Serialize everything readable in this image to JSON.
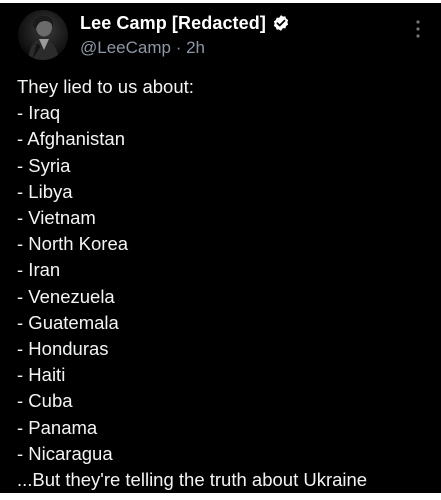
{
  "tweet": {
    "author": {
      "display_name": "Lee Camp [Redacted]",
      "handle": "@LeeCamp",
      "separator": " · ",
      "time": "2h",
      "verified_icon": "verified-badge-icon"
    },
    "more_icon": "more-vertical-icon",
    "lines": [
      "They lied to us about:",
      "- Iraq",
      "- Afghanistan",
      "- Syria",
      "- Libya",
      "- Vietnam",
      "- North Korea",
      "- Iran",
      "- Venezuela",
      "- Guatemala",
      "- Honduras",
      "- Haiti",
      "- Cuba",
      "- Panama",
      "- Nicaragua",
      "...But they're telling the truth about Ukraine"
    ]
  },
  "colors": {
    "background": "#000000",
    "text": "#e7e9ea",
    "secondary_text": "#8b98a5",
    "frame": "#ffffff"
  }
}
